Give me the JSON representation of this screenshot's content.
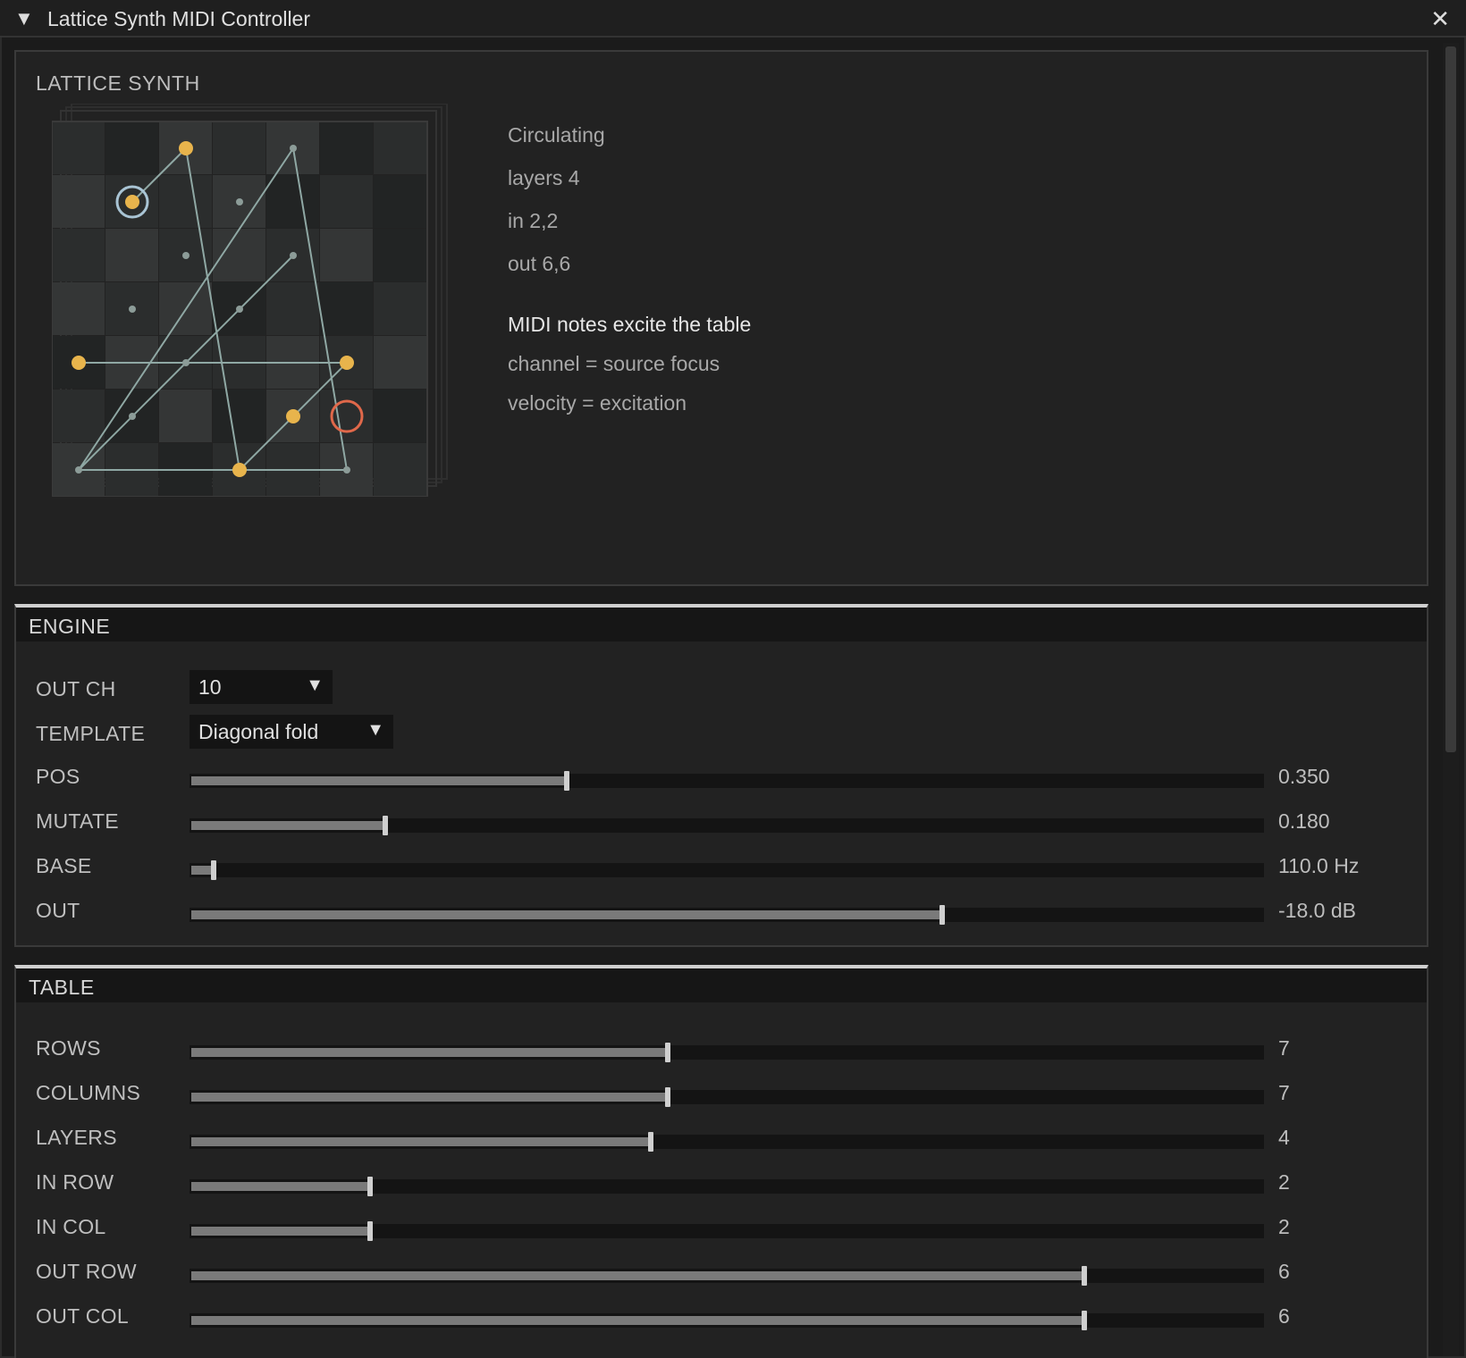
{
  "window": {
    "title": "Lattice Synth MIDI Controller",
    "collapse_glyph": "▼",
    "close_glyph": "✕"
  },
  "lattice": {
    "title": "LATTICE SYNTH",
    "info": {
      "mode": "Circulating",
      "layers": "layers 4",
      "input": "in 2,2",
      "output": "out 6,6",
      "midi_heading": "MIDI notes excite the table",
      "channel_note": "channel = source focus",
      "velocity_note": "velocity = excitation"
    },
    "colors": {
      "accent_node": "#e8b44c",
      "output_ring": "#e0684a",
      "input_ring": "#a9c4d4",
      "line": "#8fa8a4"
    }
  },
  "engine": {
    "header": "ENGINE",
    "out_ch": {
      "label": "OUT CH",
      "value": "10"
    },
    "template": {
      "label": "TEMPLATE",
      "value": "Diagonal fold"
    },
    "sliders": [
      {
        "label": "POS",
        "value": "0.350",
        "fraction": 0.35
      },
      {
        "label": "MUTATE",
        "value": "0.180",
        "fraction": 0.18
      },
      {
        "label": "BASE",
        "value": "110.0 Hz",
        "fraction": 0.02
      },
      {
        "label": "OUT",
        "value": "-18.0 dB",
        "fraction": 0.7
      }
    ]
  },
  "table": {
    "header": "TABLE",
    "sliders": [
      {
        "label": "ROWS",
        "value": "7",
        "fraction": 0.444
      },
      {
        "label": "COLUMNS",
        "value": "7",
        "fraction": 0.444
      },
      {
        "label": "LAYERS",
        "value": "4",
        "fraction": 0.428
      },
      {
        "label": "IN ROW",
        "value": "2",
        "fraction": 0.166
      },
      {
        "label": "IN COL",
        "value": "2",
        "fraction": 0.166
      },
      {
        "label": "OUT ROW",
        "value": "6",
        "fraction": 0.833
      },
      {
        "label": "OUT COL",
        "value": "6",
        "fraction": 0.833
      }
    ]
  }
}
